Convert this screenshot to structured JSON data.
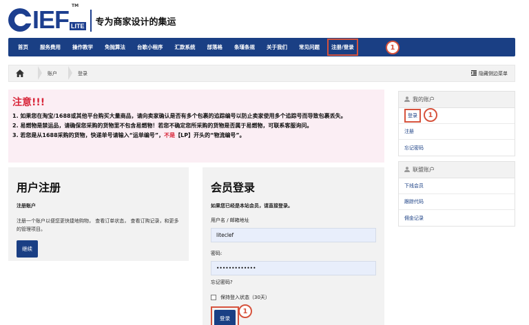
{
  "logo": {
    "brand": "IEF",
    "lite": "LITE",
    "tm": "TM",
    "slogan": "专为商家设计的集运"
  },
  "nav": {
    "items": [
      "首页",
      "服务费用",
      "操作教学",
      "免抛算法",
      "台歌小程序",
      "汇款系统",
      "部落格",
      "条瑾条规",
      "关于我们",
      "常见问题"
    ],
    "active": "注册/登录"
  },
  "badges": {
    "marker": "1"
  },
  "breadcrumb": {
    "items": [
      "账户",
      "登录"
    ],
    "toggle": "隐藏侧边菜单"
  },
  "warning": {
    "title": "注意!!!",
    "line1": "1. 如果您在淘宝/1688或其他平台购买大量商品，请向卖家确认是否有多个包裹的追踪编号以防止卖家使用多个追踪号而导致包裹丢失。",
    "line2": "2. 易燃物是禁运品，请确保您采购的货物里不包含易燃物！若您不确定您所采购的货物是否属于易燃物，可联系客服询问。",
    "line3_a": "3. 若您是从1688采购的货物，快递单号请输入“运单编号”，",
    "line3_red": "不是",
    "line3_b": "【LP】开头的“物流编号”。"
  },
  "register": {
    "title": "用户注册",
    "subtitle": "注册账户",
    "text": "注册一个账户以便您更快捷地购物， 查看订单状态， 查看订购记录，和更多的管理项目。",
    "button": "继续"
  },
  "login": {
    "title": "会员登录",
    "subtitle": "如果您已经是本站会员，请直接登录。",
    "username_label": "用户名 / 邮箱地址",
    "username_value": "liteclef",
    "password_label": "密码:",
    "password_value": "•••••••••••••",
    "forgot": "忘记密码?",
    "remember": "保持登入状态（30天）",
    "button": "登录"
  },
  "sidebar": {
    "account_title": "我的账户",
    "account_items": [
      "登录",
      "注册",
      "忘记密码"
    ],
    "affiliate_title": "联盟账户",
    "affiliate_items": [
      "下线会员",
      "跟踪代码",
      "佣金记录"
    ]
  },
  "colors": {
    "primary": "#1a3f84",
    "highlight": "#d6523c",
    "warning_text": "#d9263a",
    "warning_bg": "#fbeef4"
  }
}
